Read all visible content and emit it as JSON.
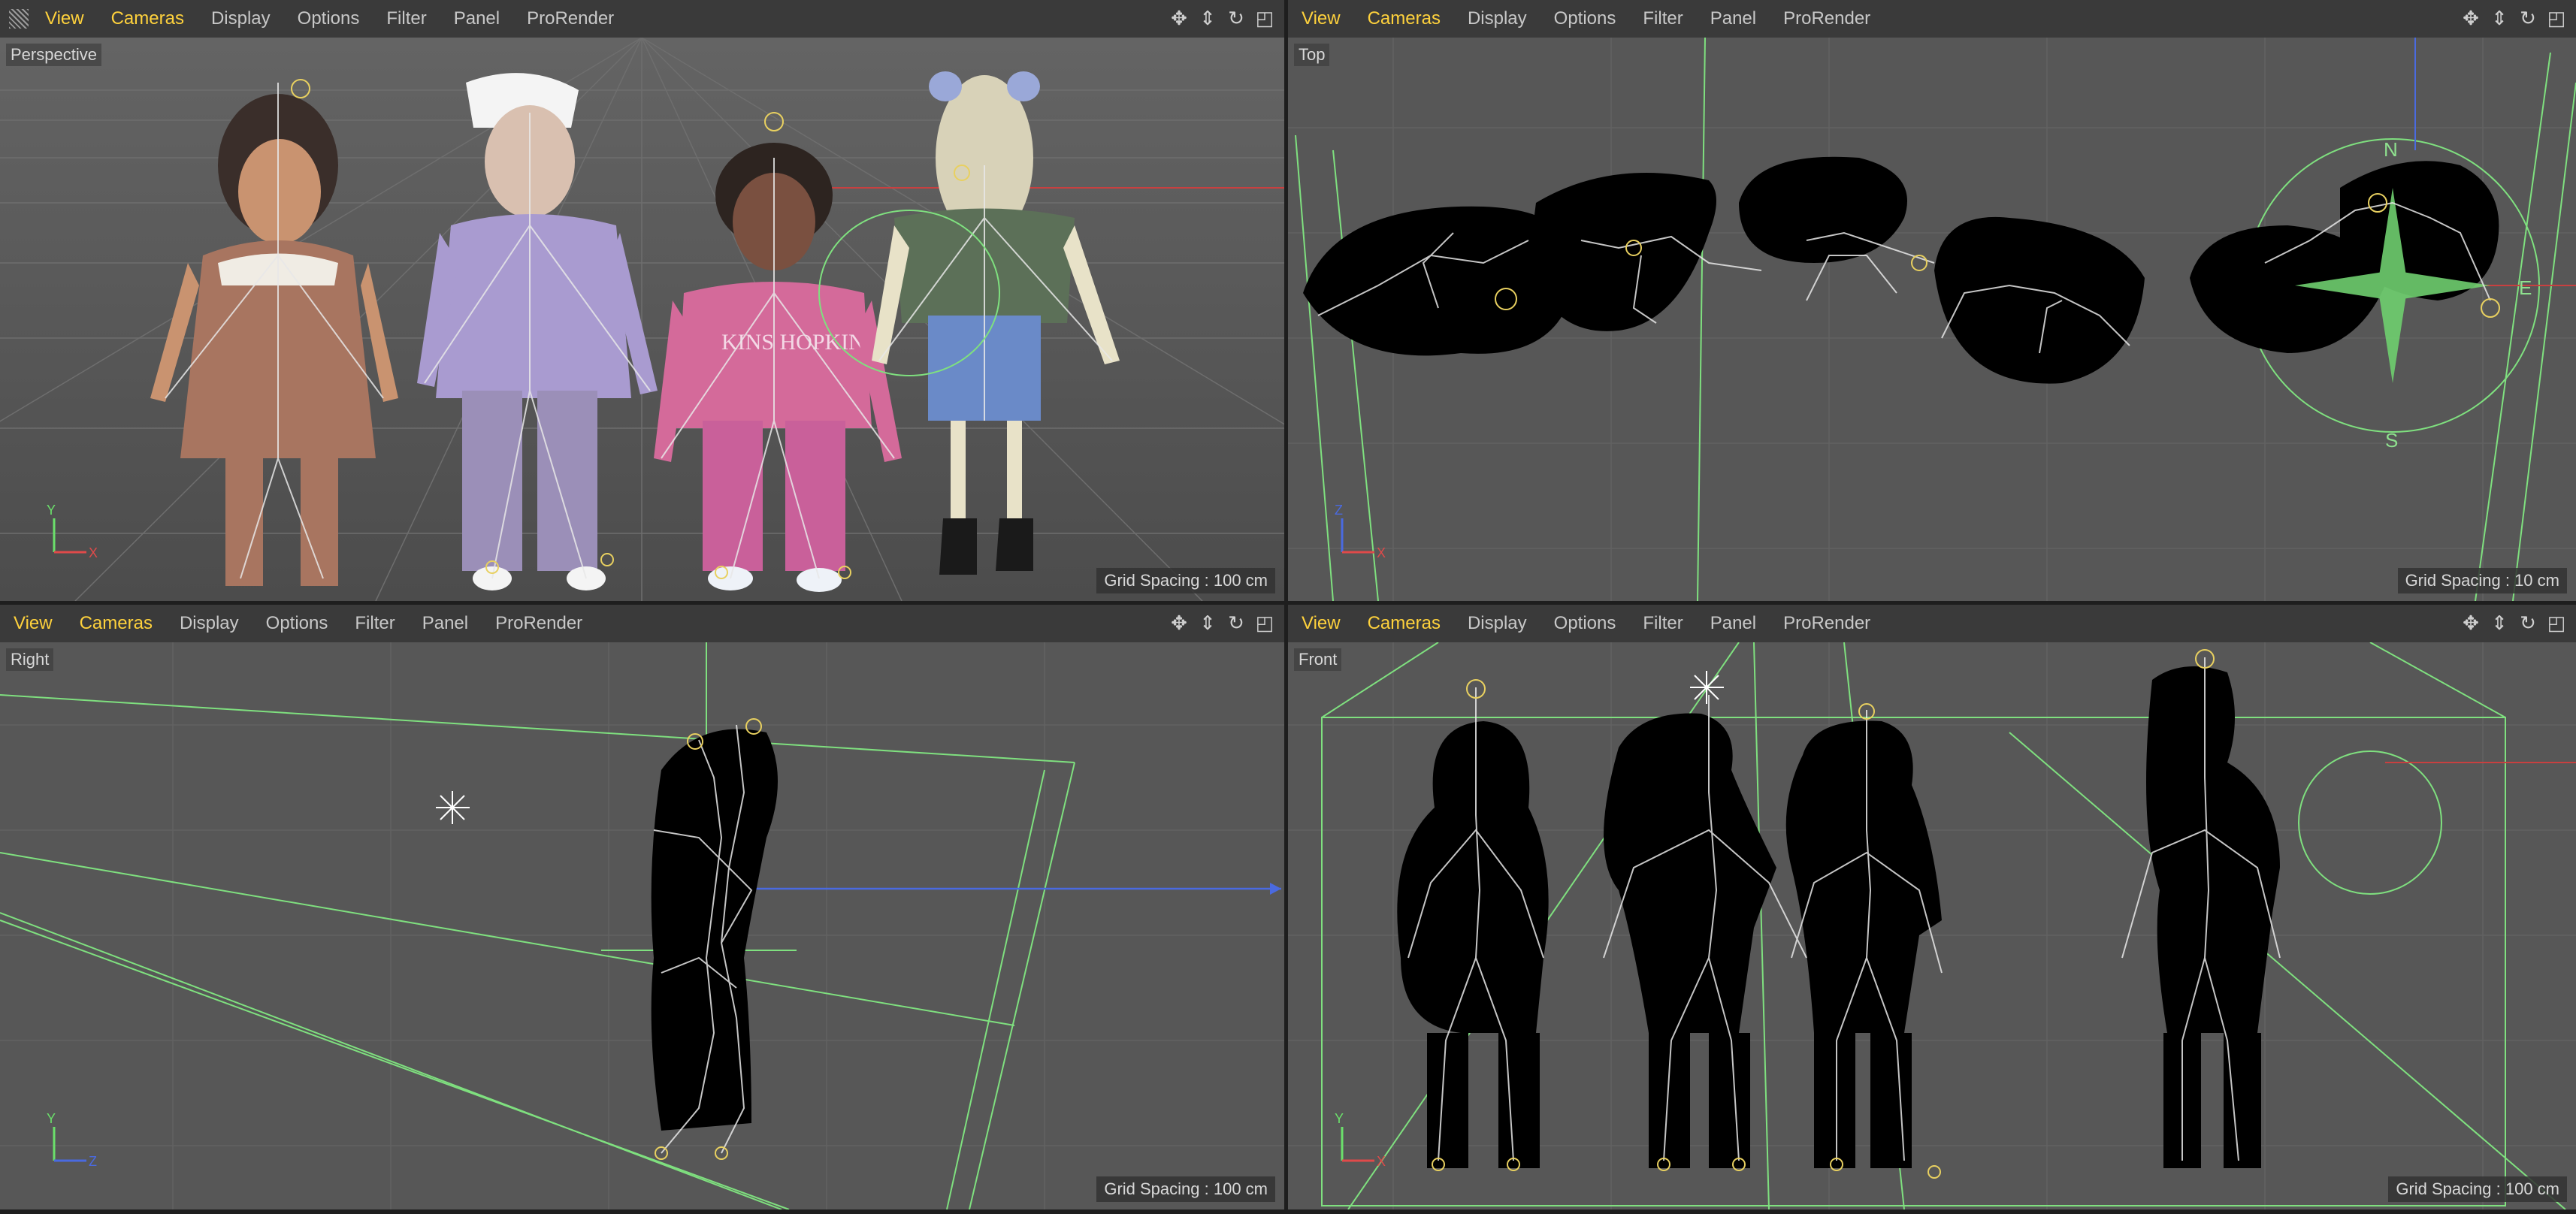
{
  "menu": [
    "View",
    "Cameras",
    "Display",
    "Options",
    "Filter",
    "Panel",
    "ProRender"
  ],
  "active_items": [
    "View",
    "Cameras"
  ],
  "viewports": [
    {
      "name": "Perspective",
      "grid_spacing": "Grid Spacing : 100 cm",
      "axes": {
        "a": "Y",
        "b": "X"
      }
    },
    {
      "name": "Top",
      "grid_spacing": "Grid Spacing : 10 cm",
      "axes": {
        "a": "Z",
        "b": "X"
      }
    },
    {
      "name": "Right",
      "grid_spacing": "Grid Spacing : 100 cm",
      "axes": {
        "a": "Y",
        "b": "Z"
      }
    },
    {
      "name": "Front",
      "grid_spacing": "Grid Spacing : 100 cm",
      "axes": {
        "a": "Y",
        "b": "X"
      }
    }
  ],
  "compass": {
    "n": "N",
    "s": "S",
    "e": "E"
  },
  "shirt_text": "KINS HOPKINS",
  "nav_icons": [
    "move-icon",
    "pan-icon",
    "rotate-icon",
    "maximize-icon"
  ],
  "colors": {
    "accent": "#ffd23c",
    "viewport_bg": "#575757",
    "menubar": "#3a3a3a",
    "focus_border": "#c8464a",
    "guide": "#7fe07f"
  }
}
